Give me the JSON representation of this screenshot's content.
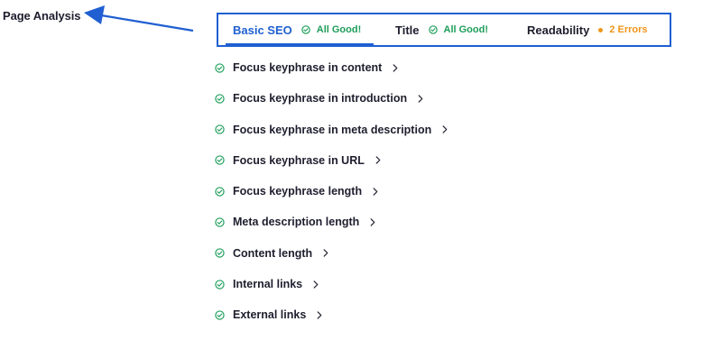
{
  "annotation": {
    "label": "Page Analysis"
  },
  "tabs": [
    {
      "label": "Basic SEO",
      "status": "All Good!",
      "status_type": "good",
      "active": true
    },
    {
      "label": "Title",
      "status": "All Good!",
      "status_type": "good",
      "active": false
    },
    {
      "label": "Readability",
      "status": "2 Errors",
      "status_type": "error",
      "active": false
    }
  ],
  "checks": [
    {
      "label": "Focus keyphrase in content",
      "status": "pass"
    },
    {
      "label": "Focus keyphrase in introduction",
      "status": "pass"
    },
    {
      "label": "Focus keyphrase in meta description",
      "status": "pass"
    },
    {
      "label": "Focus keyphrase in URL",
      "status": "pass"
    },
    {
      "label": "Focus keyphrase length",
      "status": "pass"
    },
    {
      "label": "Meta description length",
      "status": "pass"
    },
    {
      "label": "Content length",
      "status": "pass"
    },
    {
      "label": "Internal links",
      "status": "pass"
    },
    {
      "label": "External links",
      "status": "pass"
    }
  ],
  "colors": {
    "accent": "#1f5fd1",
    "good": "#1e9e5a",
    "error": "#f0951a",
    "text": "#1e1e2e"
  },
  "icons": {
    "check": "check-circle-icon",
    "chevron": "chevron-right-icon",
    "error": "error-dot-icon",
    "arrow": "arrow-left-icon"
  }
}
